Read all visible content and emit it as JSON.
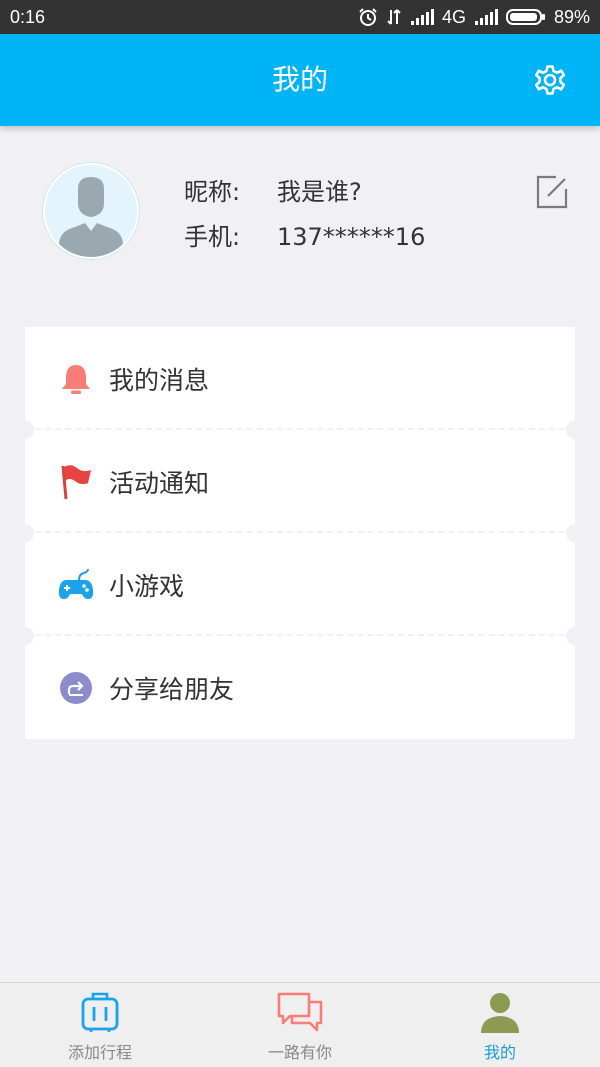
{
  "status_bar": {
    "time": "0:16",
    "network": "4G",
    "battery": "89%"
  },
  "header": {
    "title": "我的",
    "settings_icon": "gear-icon"
  },
  "profile": {
    "avatar_icon": "default-user-avatar",
    "nickname_label": "昵称:",
    "nickname_value": "我是谁?",
    "phone_label": "手机:",
    "phone_value": "137******16",
    "edit_icon": "edit-icon"
  },
  "menu": {
    "items": [
      {
        "label": "我的消息",
        "icon": "bell-icon",
        "color": "#f87d76"
      },
      {
        "label": "活动通知",
        "icon": "flag-icon",
        "color": "#e84343"
      },
      {
        "label": "小游戏",
        "icon": "gamepad-icon",
        "color": "#1aa3e8"
      },
      {
        "label": "分享给朋友",
        "icon": "share-icon",
        "color": "#8c8ccc"
      }
    ]
  },
  "bottom_nav": {
    "items": [
      {
        "label": "添加行程",
        "icon": "luggage-icon",
        "active": false
      },
      {
        "label": "一路有你",
        "icon": "chat-bubbles-icon",
        "active": false
      },
      {
        "label": "我的",
        "icon": "user-icon",
        "active": true
      }
    ]
  },
  "colors": {
    "accent": "#00b4f5",
    "background": "#f1f0f5",
    "active_tab": "#1a9be0"
  }
}
